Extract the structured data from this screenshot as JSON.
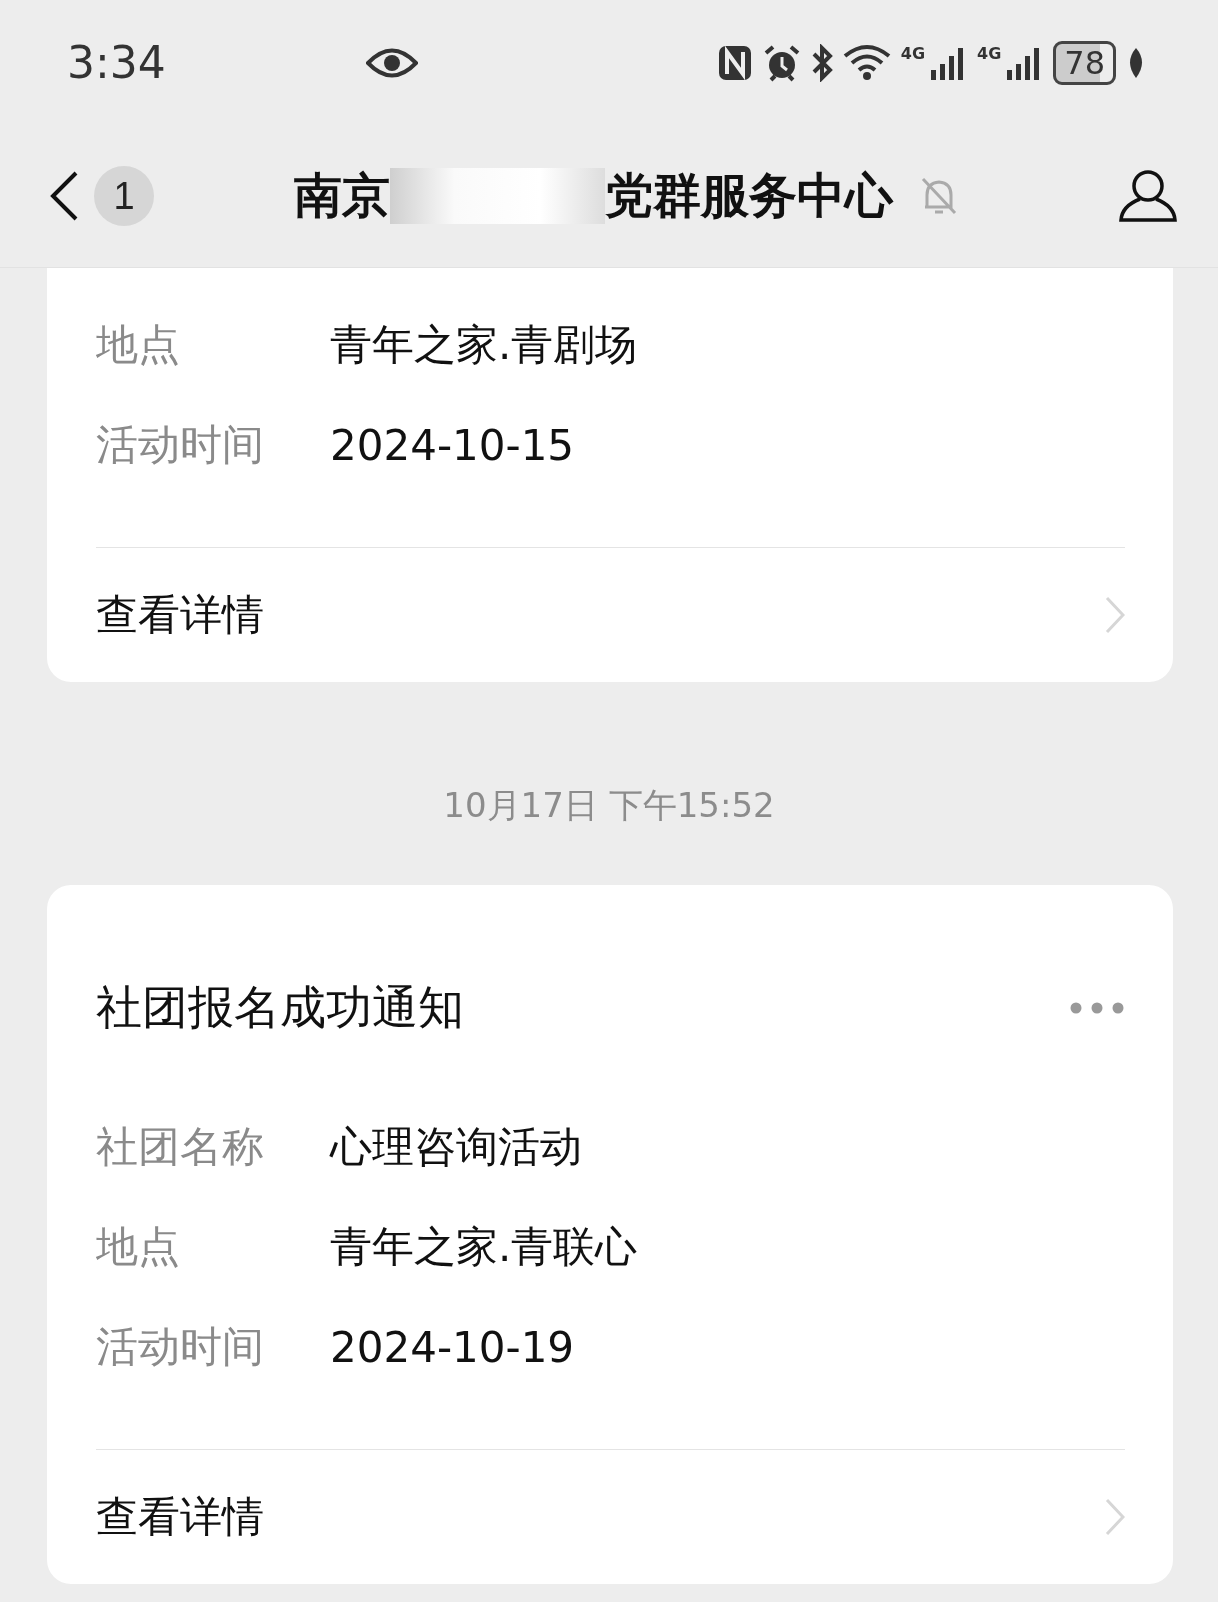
{
  "status_bar": {
    "time": "3:34",
    "signals": [
      "4G",
      "4G"
    ],
    "battery": "78"
  },
  "header": {
    "back_badge": "1",
    "title_start": "南京",
    "title_end": "党群服务中心",
    "muted": true
  },
  "messages": [
    {
      "kind": "card",
      "fields": [
        {
          "label": "地点",
          "value": "青年之家.青剧场"
        },
        {
          "label": "活动时间",
          "value": "2024-10-15"
        }
      ],
      "link": "查看详情"
    },
    {
      "kind": "time",
      "text": "10月17日 下午15:52"
    },
    {
      "kind": "card",
      "title": "社团报名成功通知",
      "fields": [
        {
          "label": "社团名称",
          "value": "心理咨询活动"
        },
        {
          "label": "地点",
          "value": "青年之家.青联心"
        },
        {
          "label": "活动时间",
          "value": "2024-10-19"
        }
      ],
      "link": "查看详情"
    }
  ]
}
